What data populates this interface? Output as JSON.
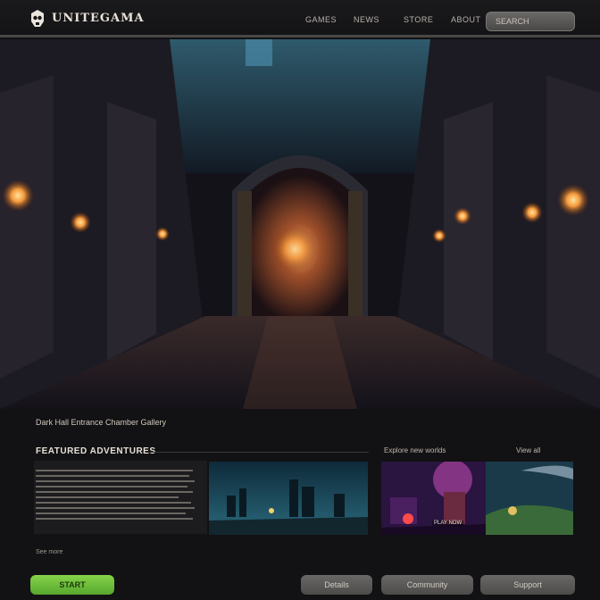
{
  "header": {
    "brand": "UNITEGAMA",
    "nav": [
      "GAMES",
      "NEWS",
      "STORE",
      "ABOUT"
    ],
    "search_label": "SEARCH"
  },
  "hero": {
    "caption": "Dark Hall Entrance Chamber Gallery"
  },
  "section": {
    "title": "FEATURED ADVENTURES",
    "links": [
      "Explore new worlds",
      "View all"
    ],
    "thumb_label": "PLAY NOW",
    "note": "See more"
  },
  "footer_buttons": {
    "primary": "START",
    "b2": "Details",
    "b3": "Community",
    "b4": "Support"
  },
  "colors": {
    "accent": "#6cc03c",
    "background": "#121113"
  }
}
